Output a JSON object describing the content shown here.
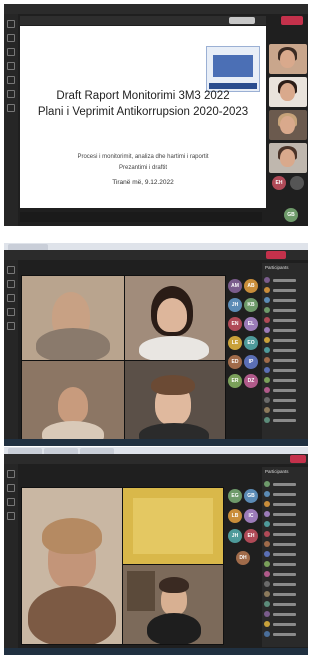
{
  "shot1": {
    "slide": {
      "title_line1": "Draft Raport Monitorimi  3M3 2022",
      "title_line2": "Plani i Veprimit Antikorrupsion 2020-2023",
      "subtitle_line1": "Procesi i monitorimit, analiza dhe hartimi i raportit",
      "subtitle_line2": "Prezantimi i draftit",
      "date": "Tiranë më, 9.12.2022"
    },
    "tile_initials": "EH",
    "tile_initials_2": "GB"
  },
  "shot2": {
    "panel_title": "Participants",
    "leave_label": "Leave",
    "avatars": [
      "AM",
      "AB",
      "JH",
      "KB",
      "EN",
      "EL",
      "LE",
      "EO",
      "ED",
      "IP",
      "ER",
      "DZ"
    ]
  },
  "shot3": {
    "panel_title": "Participants",
    "leave_label": "Leave",
    "avatars": [
      "EG",
      "GB",
      "LB",
      "IC",
      "JH",
      "EH",
      "DH"
    ]
  },
  "colors": {
    "teams_dark": "#1f1f1f",
    "leave_red": "#c4314b",
    "slide_white": "#ffffff"
  }
}
